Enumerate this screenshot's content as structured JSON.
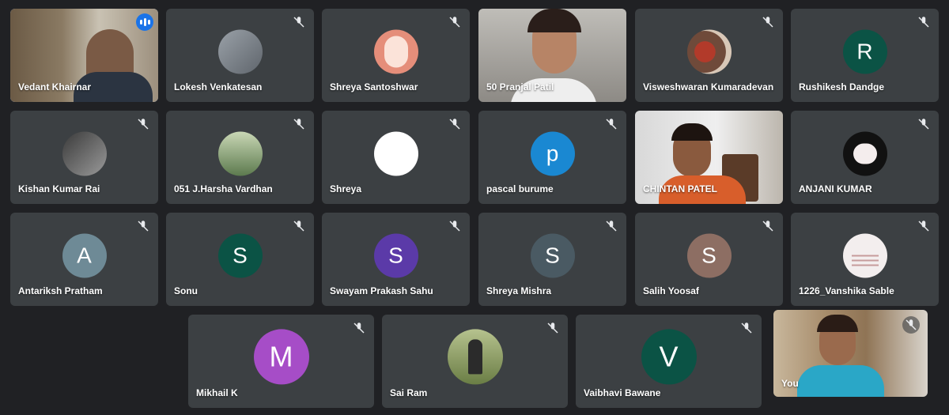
{
  "participants": [
    {
      "name": "Vedant Khairnar",
      "kind": "video",
      "speaking": true
    },
    {
      "name": "Lokesh Venkatesan",
      "kind": "photo",
      "color": "#7a7f86"
    },
    {
      "name": "Shreya Santoshwar",
      "kind": "photo",
      "color": "#e58e7a"
    },
    {
      "name": "50 Pranjal Patil",
      "kind": "video"
    },
    {
      "name": "Visweshwaran Kumaradevan",
      "kind": "photo",
      "color": "#a45b3f"
    },
    {
      "name": "Rushikesh Dandge",
      "kind": "letter",
      "letter": "R",
      "color": "#0b5345"
    },
    {
      "name": "Kishan Kumar Rai",
      "kind": "photo",
      "color": "#555555"
    },
    {
      "name": "051 J.Harsha Vardhan",
      "kind": "photo",
      "color": "#6f8f6a"
    },
    {
      "name": "Shreya",
      "kind": "photo",
      "color": "#ffffff"
    },
    {
      "name": "pascal burume",
      "kind": "letter",
      "letter": "p",
      "color": "#1a88d2"
    },
    {
      "name": "CHINTAN PATEL",
      "kind": "video"
    },
    {
      "name": "ANJANI KUMAR",
      "kind": "photo",
      "color": "#111111"
    },
    {
      "name": "Antariksh Pratham",
      "kind": "letter",
      "letter": "A",
      "color": "#6e8a96"
    },
    {
      "name": "Sonu",
      "kind": "letter",
      "letter": "S",
      "color": "#0b5345"
    },
    {
      "name": "Swayam Prakash Sahu",
      "kind": "letter",
      "letter": "S",
      "color": "#5b3aa8"
    },
    {
      "name": "Shreya Mishra",
      "kind": "letter",
      "letter": "S",
      "color": "#4a5a63"
    },
    {
      "name": "Salih Yoosaf",
      "kind": "letter",
      "letter": "S",
      "color": "#8d6e63"
    },
    {
      "name": "1226_Vanshika Sable",
      "kind": "photo",
      "color": "#f3eeee"
    },
    {
      "name": "Mikhail K",
      "kind": "letter",
      "letter": "M",
      "color": "#a64dc7"
    },
    {
      "name": "Sai Ram",
      "kind": "photo",
      "color": "#7a8a55"
    },
    {
      "name": "Vaibhavi Bawane",
      "kind": "letter",
      "letter": "V",
      "color": "#0b5345"
    },
    {
      "name": "You",
      "kind": "video"
    }
  ]
}
